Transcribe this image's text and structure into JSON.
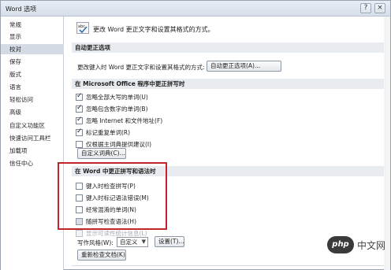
{
  "window": {
    "title": "Word 选项",
    "help_label": "?",
    "close_label": "×"
  },
  "sidebar": {
    "items": [
      {
        "label": "常规"
      },
      {
        "label": "显示"
      },
      {
        "label": "校对",
        "selected": true
      },
      {
        "label": "保存"
      },
      {
        "label": "版式"
      },
      {
        "label": "语言"
      },
      {
        "label": "轻松访问"
      },
      {
        "label": "高级"
      },
      {
        "label": "自定义功能区"
      },
      {
        "label": "快速访问工具栏"
      },
      {
        "label": "加载项"
      },
      {
        "label": "信任中心"
      }
    ]
  },
  "main": {
    "intro": "更改 Word 更正文字和设置其格式的方式。",
    "autocorrect": {
      "heading": "自动更正选项",
      "description": "更改键入时 Word 更正文字和设置其格式的方式:",
      "button": "自动更正选项(A)..."
    },
    "office": {
      "heading": "在 Microsoft Office 程序中更正拼写时",
      "options": [
        {
          "label": "忽略全部大写的单词(U)",
          "checked": true
        },
        {
          "label": "忽略包含数字的单词(B)",
          "checked": true
        },
        {
          "label": "忽略 Internet 和文件地址(F)",
          "checked": true
        },
        {
          "label": "标记重复单词(R)",
          "checked": true
        },
        {
          "label": "仅根据主词典提供建议(I)",
          "checked": false
        }
      ],
      "dictionary_button": "自定义词典(C)..."
    },
    "word": {
      "heading": "在 Word 中更正拼写和语法时",
      "options": [
        {
          "label": "键入时检查拼写(P)",
          "checked": false,
          "disabled": false
        },
        {
          "label": "键入时标记语法错误(M)",
          "checked": false,
          "disabled": false
        },
        {
          "label": "经常混淆的单词(N)",
          "checked": false,
          "disabled": false
        },
        {
          "label": "随拼写检查语法(H)",
          "checked": false,
          "disabled": false
        },
        {
          "label": "显示可读性统计信息(L)",
          "checked": false,
          "disabled": true
        }
      ],
      "style_label": "写作风格(W):",
      "style_value": "自定义",
      "settings_button": "设置(T)...",
      "recheck_button": "重新检查文档(K)"
    }
  },
  "watermark": {
    "logo": "php",
    "text": "中文网"
  },
  "colors": {
    "highlight_box": "#c0262b",
    "selected_nav": "#d5dbe4",
    "section_bg": "#e8ebef"
  }
}
